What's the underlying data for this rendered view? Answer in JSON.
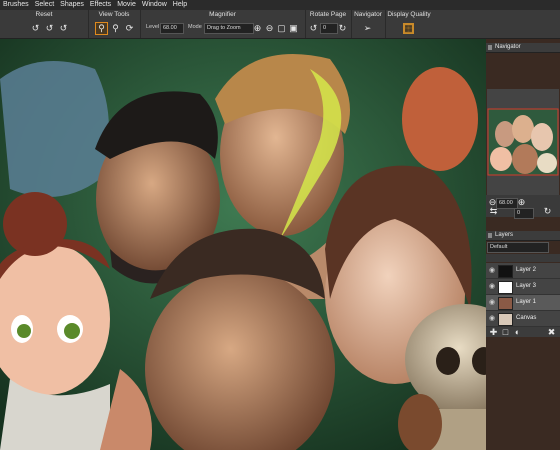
{
  "menu": [
    "Brushes",
    "Select",
    "Shapes",
    "Effects",
    "Movie",
    "Window",
    "Help"
  ],
  "toolbar": {
    "reset_label": "Reset",
    "view_tools_label": "View Tools",
    "magnifier_label": "Magnifier",
    "level_label": "Level",
    "level_value": "68.00",
    "mode_label": "Mode",
    "mode_value": "Drag to Zoom",
    "rotate_label": "Rotate Page",
    "rotate_value": "0",
    "navigator_label": "Navigator",
    "display_quality_label": "Display Quality"
  },
  "navigator": {
    "title": "Navigator",
    "zoom_value": "68.00",
    "rotate_value": "0"
  },
  "layers": {
    "title": "Layers",
    "composite_method": "Default",
    "items": [
      {
        "name": "Layer 2"
      },
      {
        "name": "Layer 3"
      },
      {
        "name": "Layer 1"
      },
      {
        "name": "Canvas"
      }
    ]
  },
  "colors": {
    "canvas_bg": "#2a5a3e",
    "accent": "#e08a1e",
    "panel_bg": "#3a3a3a"
  }
}
